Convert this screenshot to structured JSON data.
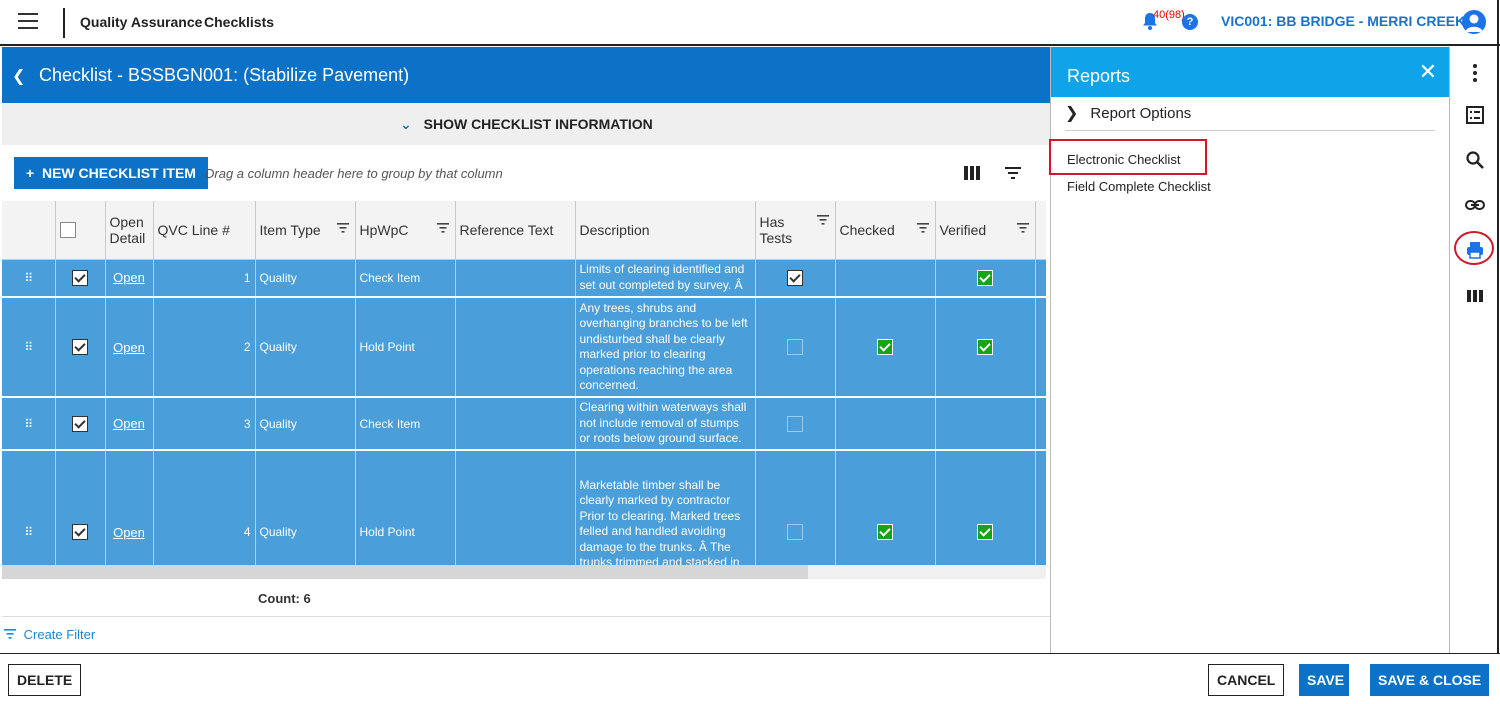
{
  "topbar": {
    "crumb1": "Quality Assurance",
    "crumb2": "Checklists",
    "notification_count": "40(98)",
    "help_label": "?",
    "project": "VIC001: BB BRIDGE - MERRI CREEK"
  },
  "checklist": {
    "title": "Checklist - BSSBGN001: (Stabilize Pavement)",
    "show_info_label": "SHOW CHECKLIST INFORMATION",
    "new_item_label": "NEW CHECKLIST ITEM",
    "drag_hint": "Drag a column header here to group by that column"
  },
  "grid": {
    "columns": {
      "open_detail": "Open Detail",
      "qvc_line": "QVC Line #",
      "item_type": "Item Type",
      "hpwpc": "HpWpC",
      "reference_text": "Reference Text",
      "description": "Description",
      "has_tests": "Has Tests",
      "checked": "Checked",
      "verified": "Verified"
    },
    "rows": [
      {
        "selected": true,
        "open": "Open",
        "line": "1",
        "item_type": "Quality",
        "hpwpc": "Check Item",
        "reference_text": "",
        "description": "Limits of clearing identified and set out completed by survey. Â",
        "has_tests": true,
        "checked": false,
        "verified": true
      },
      {
        "selected": true,
        "open": "Open",
        "line": "2",
        "item_type": "Quality",
        "hpwpc": "Hold Point",
        "reference_text": "",
        "description": "Any trees, shrubs and overhanging branches to be left undisturbed shall be clearly marked prior to clearing operations reaching the area concerned.",
        "has_tests": false,
        "checked": true,
        "verified": true
      },
      {
        "selected": true,
        "open": "Open",
        "line": "3",
        "item_type": "Quality",
        "hpwpc": "Check Item",
        "reference_text": "",
        "description": "Clearing within waterways shall not include removal of stumps or roots below ground surface.",
        "has_tests": false,
        "checked": false,
        "verified": false
      },
      {
        "selected": true,
        "open": "Open",
        "line": "4",
        "item_type": "Quality",
        "hpwpc": "Hold Point",
        "reference_text": "",
        "description": "Marketable timber shall be clearly marked by contractor Prior to clearing. Marked trees felled and handled avoiding damage to the trunks. Â The trunks trimmed and stacked in neat manageable stockpiles",
        "has_tests": false,
        "checked": true,
        "verified": true
      }
    ],
    "count_label": "Count: 6",
    "create_filter": "Create Filter"
  },
  "reports": {
    "title": "Reports",
    "options_label": "Report Options",
    "items": [
      "Electronic Checklist",
      "Field Complete Checklist"
    ]
  },
  "footer": {
    "delete": "DELETE",
    "cancel": "CANCEL",
    "save": "SAVE",
    "save_close": "SAVE & CLOSE"
  },
  "colors": {
    "primary": "#0c72c7",
    "selected_row": "#4a9fdb",
    "reports_header": "#0fa3ea",
    "checked_green": "#17a418",
    "highlight_red": "#d0182a"
  }
}
